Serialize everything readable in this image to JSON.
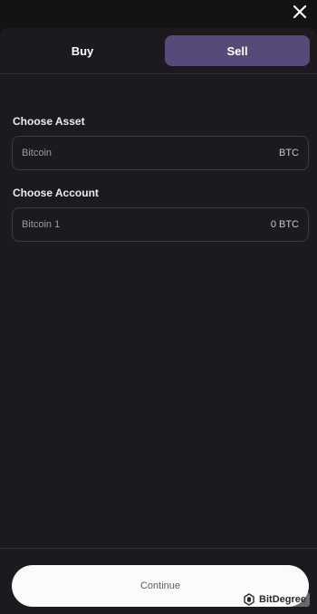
{
  "header": {
    "close_icon": "close-icon"
  },
  "tabs": [
    {
      "label": "Buy",
      "active": false
    },
    {
      "label": "Sell",
      "active": true
    }
  ],
  "asset": {
    "label": "Choose Asset",
    "value": "Bitcoin",
    "ticker": "BTC"
  },
  "account": {
    "label": "Choose Account",
    "value": "Bitcoin 1",
    "balance": "0 BTC"
  },
  "footer": {
    "continue_label": "Continue"
  },
  "watermark": {
    "text": "BitDegree"
  },
  "colors": {
    "background": "#131214",
    "panel": "#1c1a1f",
    "active_tab": "#574a78",
    "field_border": "#3d3a44",
    "button": "#fbfbfb"
  }
}
